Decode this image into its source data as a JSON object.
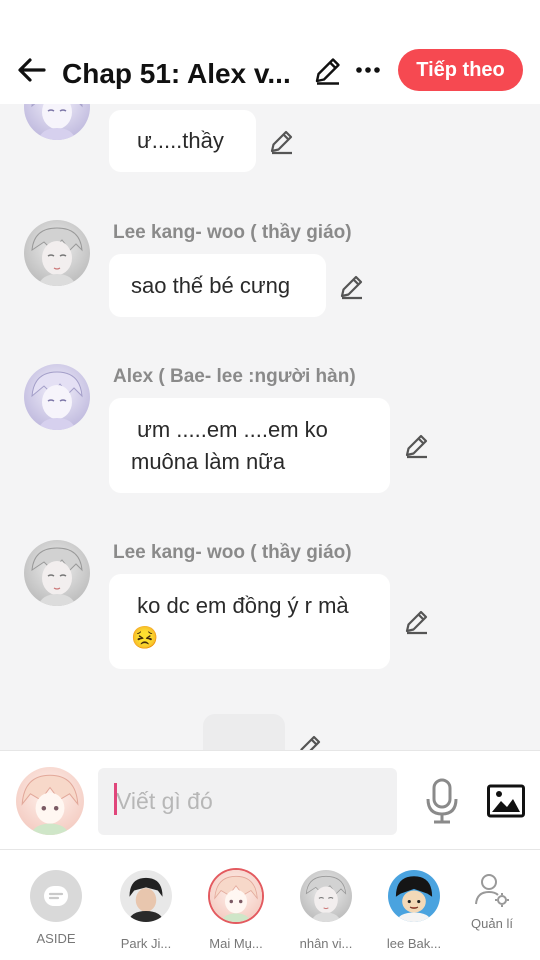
{
  "header": {
    "title": "Chap 51: Alex v...",
    "next_label": "Tiếp theo"
  },
  "messages": [
    {
      "sender": "",
      "lines": [
        "ư.....thầy"
      ]
    },
    {
      "sender": "Lee kang- woo ( thầy giáo)",
      "lines": [
        "sao thế bé cưng"
      ]
    },
    {
      "sender": "Alex (  Bae- lee :người hàn)",
      "lines": [
        " ưm .....em ....em ko",
        "muôna làm nữa"
      ]
    },
    {
      "sender": "Lee kang- woo ( thầy giáo)",
      "lines": [
        " ko dc em đồng ý r mà",
        "😣"
      ]
    }
  ],
  "composer": {
    "placeholder": "Viết gì đó",
    "value": ""
  },
  "characters": [
    {
      "label": "ASIDE",
      "icon": "aside-icon"
    },
    {
      "label": "Park Ji...",
      "icon": "avatar"
    },
    {
      "label": "Mai Mụ...",
      "icon": "avatar",
      "selected": true
    },
    {
      "label": "nhân vi...",
      "icon": "avatar"
    },
    {
      "label": "lee Bak...",
      "icon": "avatar"
    }
  ],
  "manage_label": "Quản lí",
  "colors": {
    "accent": "#f64951",
    "background": "#f4f4f5",
    "bubble": "#ffffff",
    "sender_text": "#8a8a8a"
  }
}
